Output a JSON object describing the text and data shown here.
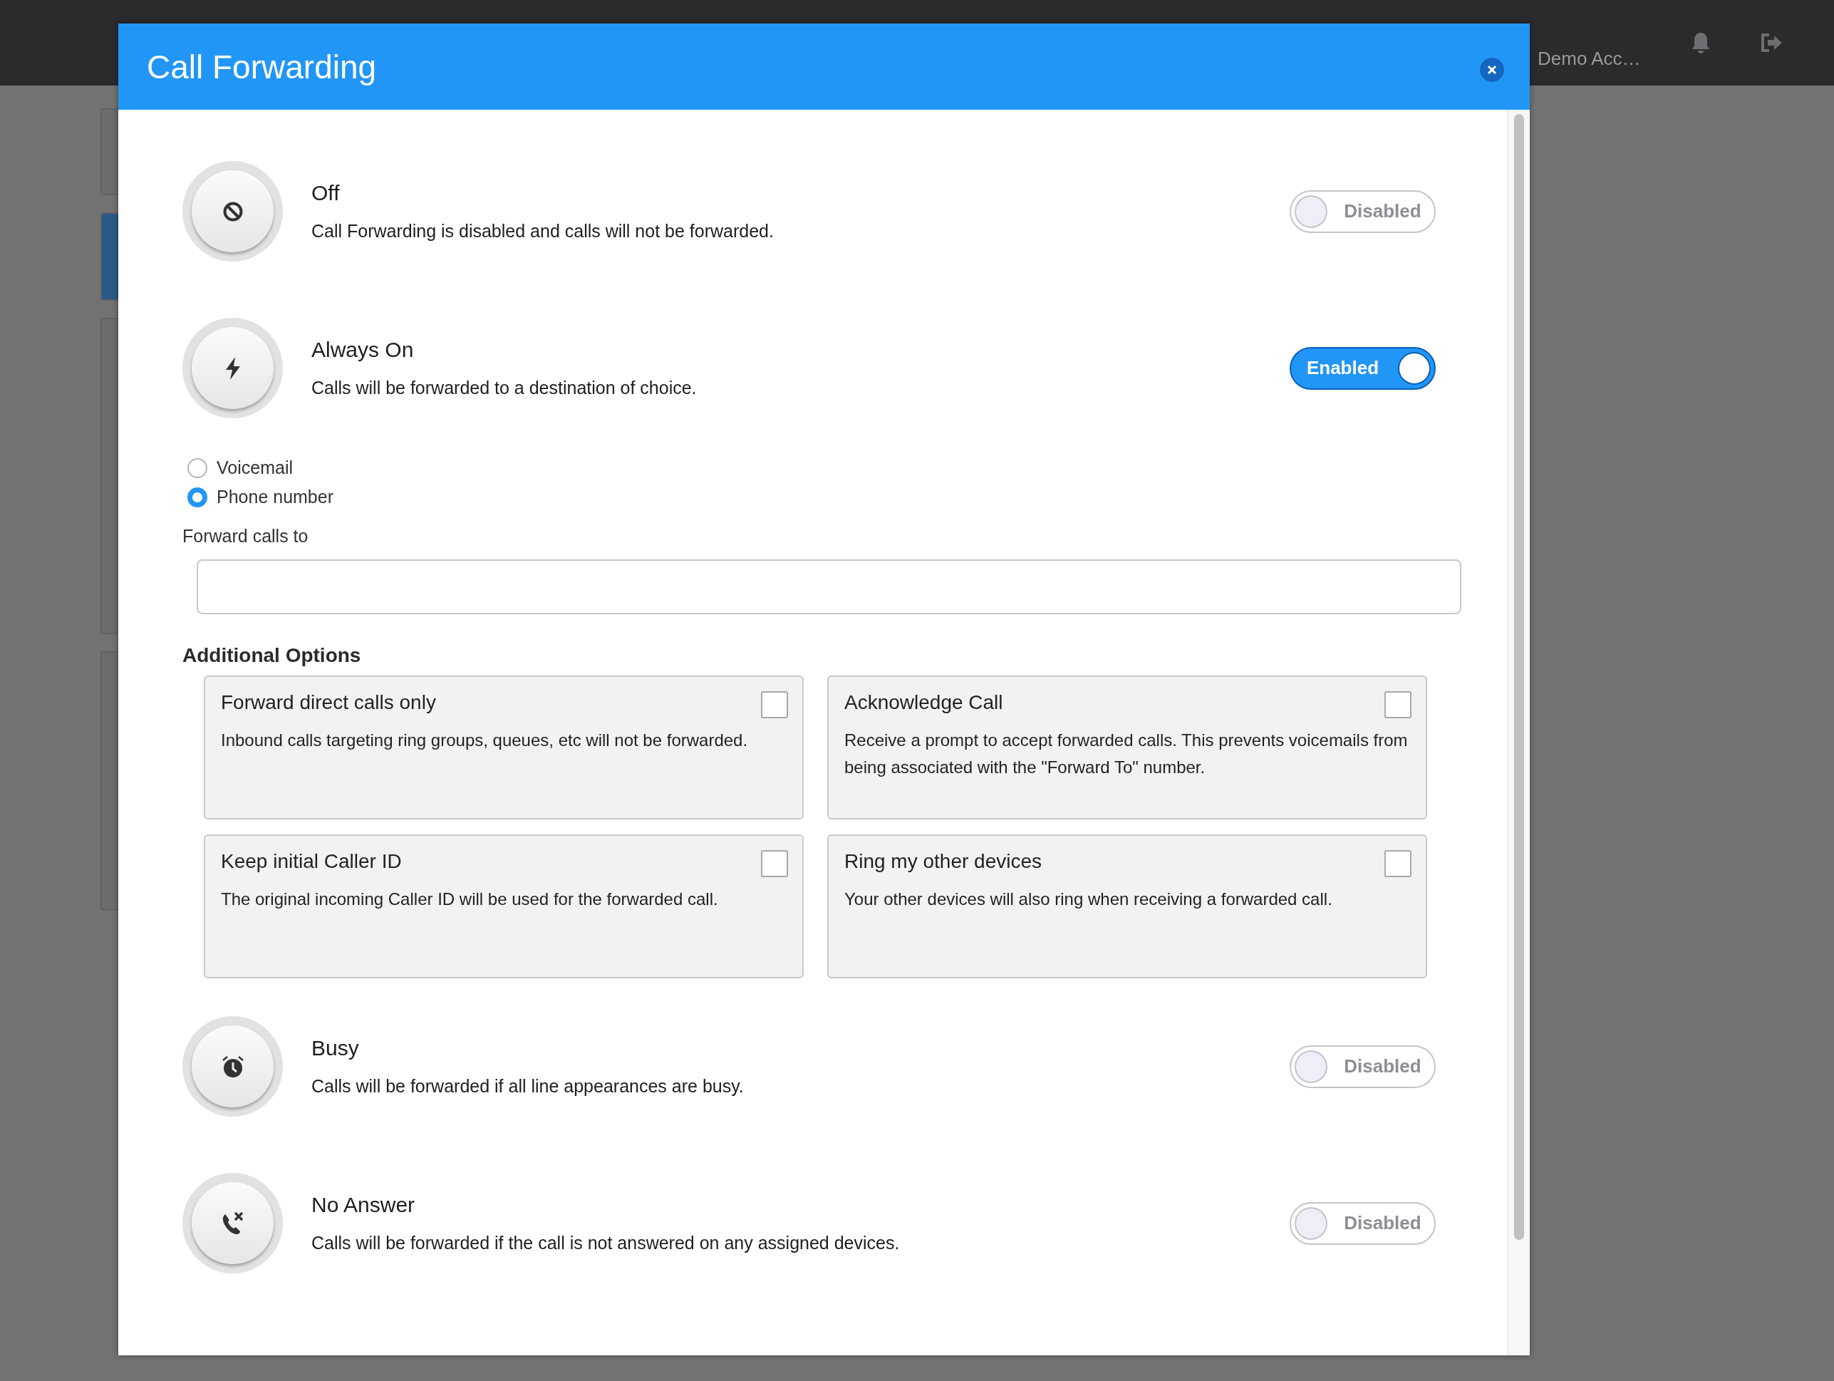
{
  "app_bar": {
    "account": "Demo Acc…"
  },
  "dialog": {
    "title": "Call Forwarding",
    "modes": [
      {
        "kind": "off",
        "title": "Off",
        "description": "Call Forwarding is disabled and calls will not be forwarded.",
        "toggle": {
          "label": "Disabled",
          "on": false
        }
      },
      {
        "kind": "always",
        "title": "Always On",
        "description": "Calls will be forwarded to a destination of choice.",
        "toggle": {
          "label": "Enabled",
          "on": true
        },
        "destination": {
          "options": [
            {
              "label": "Voicemail",
              "selected": false
            },
            {
              "label": "Phone number",
              "selected": true
            }
          ],
          "field_label": "Forward calls to"
        },
        "additional_options": {
          "heading": "Additional Options",
          "options": [
            {
              "title": "Forward direct calls only",
              "description": "Inbound calls targeting ring groups, queues, etc will not be forwarded.",
              "checked": false
            },
            {
              "title": "Acknowledge Call",
              "description": "Receive a prompt to accept forwarded calls. This prevents voicemails from being associated with the \"Forward To\" number.",
              "checked": false
            },
            {
              "title": "Keep initial Caller ID",
              "description": "The original incoming Caller ID will be used for the forwarded call.",
              "checked": false
            },
            {
              "title": "Ring my other devices",
              "description": "Your other devices will also ring when receiving a forwarded call.",
              "checked": false
            }
          ]
        }
      },
      {
        "kind": "busy",
        "title": "Busy",
        "description": "Calls will be forwarded if all line appearances are busy.",
        "toggle": {
          "label": "Disabled",
          "on": false
        }
      },
      {
        "kind": "no_answer",
        "title": "No Answer",
        "description": "Calls will be forwarded if the call is not answered on any assigned devices.",
        "toggle": {
          "label": "Disabled",
          "on": false
        }
      }
    ]
  }
}
